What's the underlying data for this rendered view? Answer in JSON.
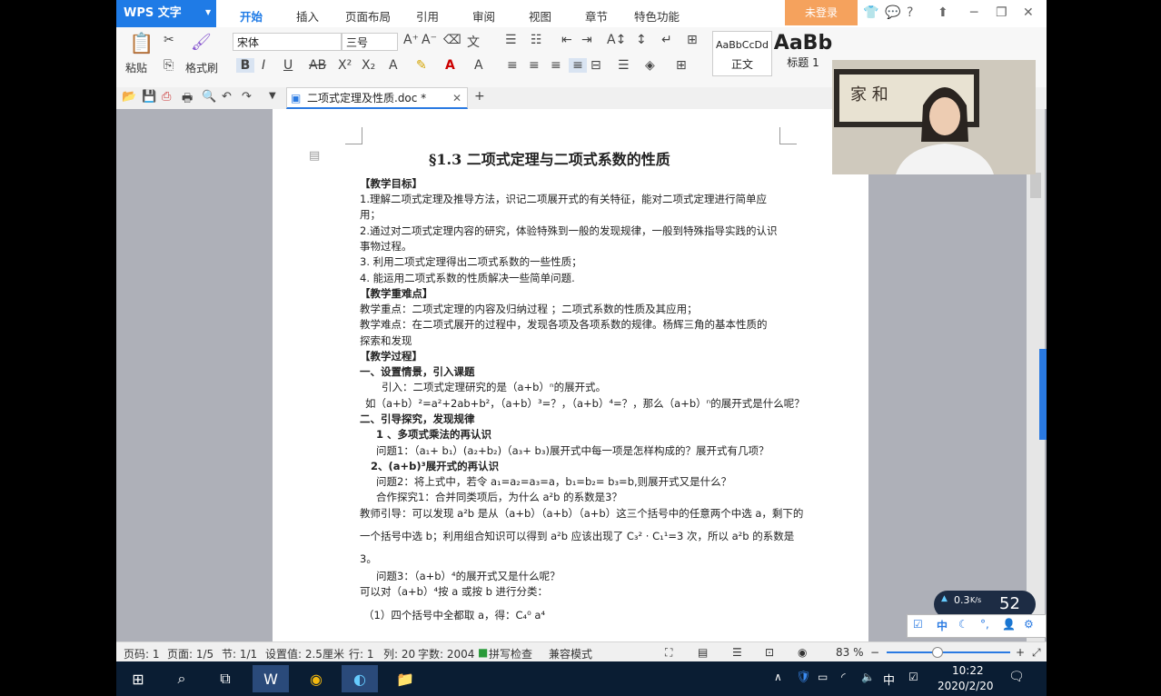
{
  "titlebar": {
    "app_name": "WPS 文字",
    "menu": [
      "开始",
      "插入",
      "页面布局",
      "引用",
      "审阅",
      "视图",
      "章节",
      "特色功能"
    ],
    "login": "未登录"
  },
  "ribbon": {
    "paste": "粘贴",
    "format_painter": "格式刷",
    "font_name": "宋体",
    "font_size": "三号",
    "style_normal_preview": "AaBbCcDd",
    "style_normal": "正文",
    "style_heading_preview": "AaBb",
    "style_heading": "标题 1"
  },
  "tabbar": {
    "doc_tab": "二项式定理及性质.doc *"
  },
  "document": {
    "title": "§1.3  二项式定理与二项式系数的性质",
    "lines": [
      "【教学目标】",
      "1.理解二项式定理及推导方法，识记二项展开式的有关特征，能对二项式定理进行简单应",
      "用；",
      "2.通过对二项式定理内容的研究，体验特殊到一般的发现规律，一般到特殊指导实践的认识",
      "事物过程。",
      "3. 利用二项式定理得出二项式系数的一些性质；",
      "4. 能运用二项式系数的性质解决一些简单问题.",
      "【教学重难点】",
      "教学重点：二项式定理的内容及归纳过程 ；二项式系数的性质及其应用；",
      "教学难点：在二项式展开的过程中，发现各项及各项系数的规律。杨辉三角的基本性质的",
      "探索和发现",
      "【教学过程】",
      "一、设置情景，引入课题",
      "引入：二项式定理研究的是（a+b）ⁿ的展开式。",
      "如（a+b）²=a²+2ab+b²，（a+b）³=？，（a+b）⁴=？，那么（a+b）ⁿ的展开式是什么呢？",
      "二、引导探究，发现规律",
      "1 、多项式乘法的再认识",
      "问题1：（a₁+ b₁）(a₂+b₂)（a₃+ b₃)展开式中每一项是怎样构成的？展开式有几项？",
      "2、(a+b)³展开式的再认识",
      "问题2：将上式中，若令 a₁=a₂=a₃=a，b₁=b₂= b₃=b,则展开式又是什么？",
      "合作探究1：合并同类项后，为什么 a²b 的系数是3？",
      "教师引导：可以发现 a²b 是从（a+b）（a+b）（a+b）这三个括号中的任意两个中选 a，剩下的",
      "一个括号中选 b；利用组合知识可以得到 a²b 应该出现了 C₃² · C₁¹=3 次，所以 a²b 的系数是",
      "3。",
      "问题3：（a+b）⁴的展开式又是什么呢？",
      "可以对（a+b）⁴按 a 或按 b 进行分类：",
      "（1）四个括号中全都取 a，得：C₄⁰ a⁴"
    ]
  },
  "statusbar": {
    "row": "页码: 1",
    "page": "页面: 1/5",
    "section": "节: 1/1",
    "setting": "设置值: 2.5厘米",
    "line": "行: 1",
    "col": "列: 20",
    "words": "字数: 2004",
    "spell": "拼写检查",
    "compat": "兼容模式",
    "zoom": "83 %"
  },
  "netwidget": {
    "speed": "0.3",
    "unit": "K/s",
    "percent": "52"
  },
  "ime": {
    "lang": "中"
  },
  "taskbar": {
    "lang": "中",
    "time": "10:22",
    "date": "2020/2/20"
  }
}
